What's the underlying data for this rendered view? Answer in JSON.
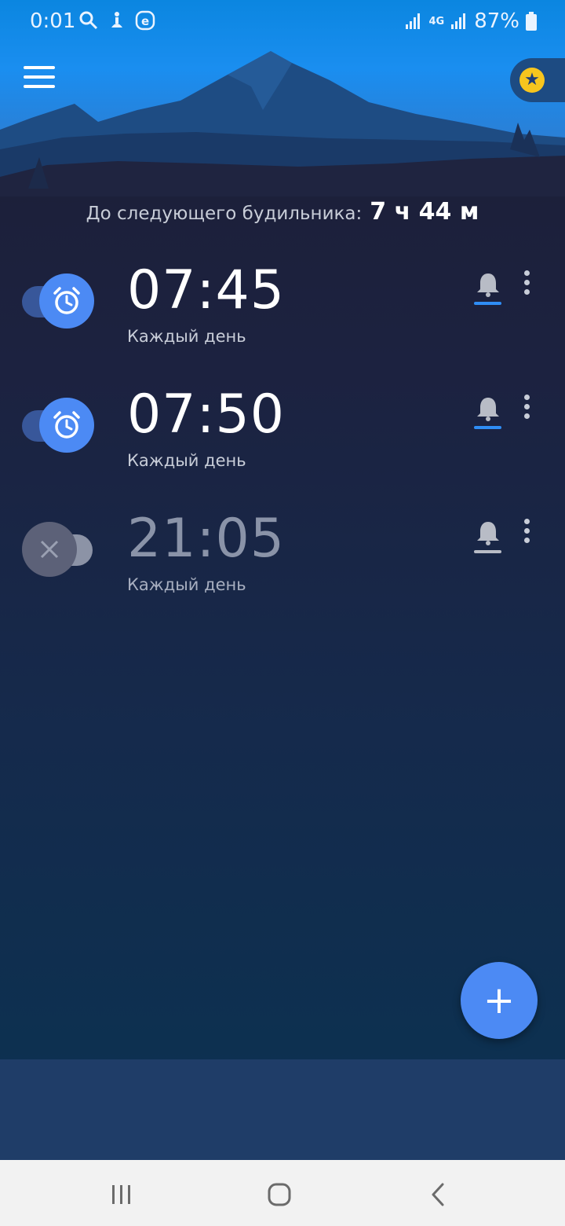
{
  "status_bar": {
    "time": "0:01",
    "network": "4G",
    "battery": "87%"
  },
  "header": {
    "menu_icon": "hamburger-menu-icon",
    "premium_icon": "star-coin-icon"
  },
  "next_alarm": {
    "label": "До следующего будильника:",
    "value": "7 ч 44 м"
  },
  "alarms": [
    {
      "time": "07:45",
      "repeat": "Каждый день",
      "enabled": true
    },
    {
      "time": "07:50",
      "repeat": "Каждый день",
      "enabled": true
    },
    {
      "time": "21:05",
      "repeat": "Каждый день",
      "enabled": false
    }
  ],
  "fab": {
    "label": "+"
  },
  "colors": {
    "accent": "#4c8af4",
    "header_sky": "#1a8ef0",
    "background_dark": "#1d1e34",
    "disabled_text": "#8a93a8",
    "premium_coin": "#f7c51e"
  }
}
